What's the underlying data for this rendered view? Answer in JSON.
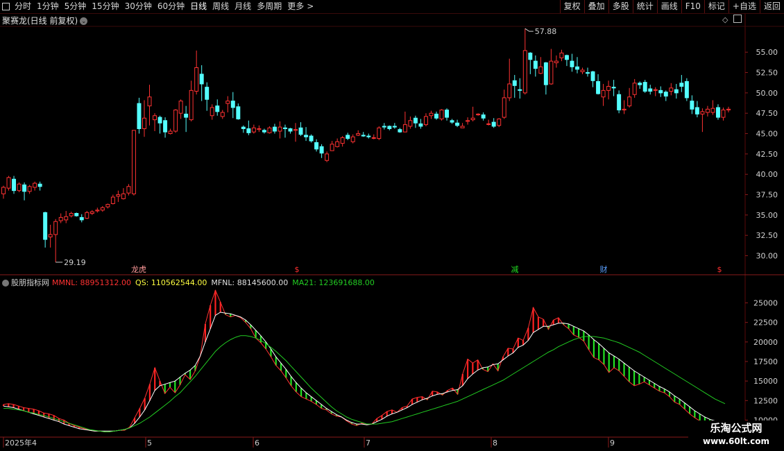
{
  "toolbar": {
    "periods": [
      "分时",
      "1分钟",
      "5分钟",
      "15分钟",
      "30分钟",
      "60分钟",
      "日线",
      "周线",
      "月线",
      "多周期",
      "更多"
    ],
    "active_period": "日线",
    "more_arrow": ">",
    "right_buttons": [
      "复权",
      "叠加",
      "多股",
      "统计",
      "画线",
      "F10",
      "标记",
      "+自选",
      "返回"
    ]
  },
  "stock": {
    "title": "聚赛龙(日线 前复权)",
    "dropdown_icon": "chevron-down-icon"
  },
  "price_axis": {
    "labels": [
      "55.00",
      "52.50",
      "50.00",
      "47.50",
      "45.00",
      "42.50",
      "40.00",
      "37.50",
      "35.00",
      "32.50",
      "30.00"
    ],
    "high_marker": "57.88",
    "low_marker": "29.19"
  },
  "event_markers": [
    "龙虎",
    "$",
    "减",
    "财",
    "$"
  ],
  "indicator": {
    "name": "股朋指标网",
    "mmnl_label": "MMNL: 88951312.00",
    "qs_label": "QS: 110562544.00",
    "mfnl_label": "MFNL: 88145600.00",
    "ma21_label": "MA21: 123691688.00",
    "axis_labels": [
      "25000",
      "22500",
      "20000",
      "17500",
      "15000",
      "12500",
      "10000"
    ]
  },
  "date_axis": {
    "labels": [
      "2025年4",
      "5",
      "6",
      "7",
      "8",
      "9"
    ]
  },
  "watermark": {
    "line1": "乐淘公式网",
    "line2": "www.60lt.com"
  },
  "colors": {
    "up": "#ff3232",
    "down": "#54ffff",
    "red_bar": "#ff2020",
    "green_bar": "#22e522",
    "qs_line": "#ffffff",
    "ma_line": "#22cc22",
    "grid": "#5a0a0a"
  },
  "chart_data": {
    "type": "candlestick",
    "y_range": [
      28,
      58
    ],
    "candles": [
      [
        37.6,
        38.4,
        37.0,
        38.6
      ],
      [
        38.3,
        39.6,
        38.0,
        39.8
      ],
      [
        39.4,
        38.0,
        37.6,
        39.8
      ],
      [
        38.0,
        38.8,
        37.8,
        39.0
      ],
      [
        38.7,
        37.9,
        36.8,
        39.0
      ],
      [
        37.9,
        38.5,
        37.6,
        38.7
      ],
      [
        38.4,
        38.9,
        38.0,
        39.1
      ],
      [
        38.8,
        38.5,
        38.0,
        39.1
      ],
      [
        35.3,
        32.0,
        31.0,
        35.4
      ],
      [
        32.3,
        32.6,
        31.0,
        33.8
      ],
      [
        32.6,
        34.2,
        29.2,
        34.5
      ],
      [
        34.3,
        34.7,
        34.0,
        35.2
      ],
      [
        34.4,
        34.8,
        34.0,
        35.5
      ],
      [
        34.9,
        35.2,
        34.7,
        35.4
      ],
      [
        35.2,
        34.9,
        34.8,
        35.3
      ],
      [
        34.7,
        34.4,
        34.1,
        35.1
      ],
      [
        34.6,
        35.3,
        34.5,
        35.5
      ],
      [
        35.2,
        35.4,
        35.0,
        35.6
      ],
      [
        35.5,
        35.6,
        35.3,
        35.9
      ],
      [
        35.6,
        35.9,
        35.4,
        36.1
      ],
      [
        36.0,
        36.3,
        35.8,
        36.4
      ],
      [
        36.4,
        37.2,
        36.3,
        37.5
      ],
      [
        37.3,
        37.5,
        36.6,
        38.0
      ],
      [
        37.0,
        37.6,
        36.9,
        38.3
      ],
      [
        37.7,
        38.5,
        37.4,
        38.8
      ],
      [
        37.6,
        45.4,
        37.4,
        45.4
      ],
      [
        48.7,
        45.6,
        45.0,
        49.4
      ],
      [
        45.6,
        46.9,
        44.6,
        49.1
      ],
      [
        48.4,
        49.5,
        46.0,
        51.0
      ],
      [
        46.7,
        47.2,
        45.3,
        47.5
      ],
      [
        47.0,
        46.3,
        45.0,
        47.2
      ],
      [
        46.6,
        45.2,
        44.5,
        47.0
      ],
      [
        45.0,
        45.3,
        44.9,
        45.6
      ],
      [
        45.3,
        47.9,
        45.1,
        48.0
      ],
      [
        47.5,
        49.0,
        46.8,
        49.2
      ],
      [
        47.4,
        47.0,
        45.2,
        48.4
      ],
      [
        46.7,
        50.3,
        46.5,
        51.5
      ],
      [
        50.2,
        53.1,
        49.8,
        55.2
      ],
      [
        52.3,
        51.1,
        49.0,
        53.4
      ],
      [
        50.7,
        49.2,
        47.8,
        51.3
      ],
      [
        47.2,
        48.2,
        46.7,
        48.6
      ],
      [
        48.4,
        47.7,
        47.2,
        49.2
      ],
      [
        47.1,
        47.6,
        46.8,
        47.9
      ],
      [
        48.7,
        49.0,
        47.6,
        49.6
      ],
      [
        49.0,
        48.2,
        46.9,
        50.1
      ],
      [
        48.3,
        46.8,
        46.7,
        48.7
      ],
      [
        45.8,
        45.6,
        45.1,
        46.0
      ],
      [
        45.6,
        45.1,
        44.8,
        46.6
      ],
      [
        45.2,
        45.7,
        45.0,
        46.1
      ],
      [
        45.5,
        45.6,
        45.2,
        46.0
      ],
      [
        45.4,
        45.2,
        45.0,
        45.6
      ],
      [
        45.1,
        45.7,
        45.0,
        45.9
      ],
      [
        45.8,
        45.3,
        45.0,
        46.2
      ],
      [
        45.3,
        45.8,
        44.4,
        46.5
      ],
      [
        45.7,
        45.6,
        44.5,
        46.1
      ],
      [
        45.6,
        45.3,
        45.0,
        45.7
      ],
      [
        45.4,
        45.5,
        44.0,
        46.3
      ],
      [
        45.7,
        44.9,
        44.7,
        46.4
      ],
      [
        44.8,
        44.6,
        44.1,
        45.8
      ],
      [
        44.7,
        44.1,
        43.9,
        44.9
      ],
      [
        43.9,
        43.1,
        42.8,
        44.3
      ],
      [
        43.4,
        42.6,
        42.0,
        43.7
      ],
      [
        41.7,
        42.5,
        41.5,
        42.8
      ],
      [
        42.9,
        43.7,
        42.9,
        44.1
      ],
      [
        43.4,
        44.0,
        43.3,
        44.4
      ],
      [
        43.8,
        44.5,
        43.4,
        44.7
      ],
      [
        44.8,
        44.4,
        44.2,
        45.1
      ],
      [
        44.0,
        44.6,
        43.8,
        44.9
      ],
      [
        44.8,
        45.0,
        44.7,
        45.4
      ],
      [
        44.8,
        44.7,
        44.6,
        45.2
      ],
      [
        44.7,
        44.6,
        44.4,
        45.0
      ],
      [
        44.5,
        44.5,
        44.3,
        44.9
      ],
      [
        44.4,
        45.7,
        44.2,
        45.9
      ],
      [
        45.9,
        45.8,
        45.5,
        46.3
      ],
      [
        45.9,
        45.6,
        45.4,
        46.0
      ],
      [
        45.9,
        45.8,
        45.6,
        46.3
      ],
      [
        45.5,
        45.2,
        45.1,
        45.7
      ],
      [
        45.2,
        46.1,
        45.2,
        47.7
      ],
      [
        45.9,
        46.6,
        45.6,
        47.1
      ],
      [
        46.9,
        46.3,
        45.7,
        47.2
      ],
      [
        46.2,
        45.9,
        45.6,
        46.8
      ],
      [
        46.1,
        47.1,
        45.9,
        47.5
      ],
      [
        47.2,
        47.5,
        46.8,
        47.8
      ],
      [
        47.4,
        46.9,
        46.7,
        47.7
      ],
      [
        46.8,
        47.9,
        46.6,
        48.0
      ],
      [
        47.9,
        47.0,
        46.6,
        48.1
      ],
      [
        46.6,
        46.4,
        46.2,
        46.8
      ],
      [
        46.3,
        46.0,
        45.8,
        46.7
      ],
      [
        45.7,
        45.9,
        45.8,
        46.3
      ],
      [
        46.5,
        46.6,
        46.1,
        47.0
      ],
      [
        46.7,
        46.9,
        46.5,
        48.3
      ],
      [
        47.3,
        47.4,
        47.2,
        47.5
      ],
      [
        47.3,
        46.9,
        46.6,
        47.6
      ],
      [
        46.2,
        46.2,
        46.0,
        46.7
      ],
      [
        46.4,
        45.9,
        45.7,
        46.9
      ],
      [
        46.0,
        46.8,
        45.8,
        46.9
      ],
      [
        47.0,
        49.4,
        46.8,
        50.4
      ],
      [
        49.4,
        51.1,
        49.0,
        54.2
      ],
      [
        51.5,
        50.9,
        49.4,
        52.2
      ],
      [
        50.4,
        50.3,
        49.3,
        51.8
      ],
      [
        50.0,
        55.2,
        49.8,
        57.9
      ],
      [
        54.9,
        54.1,
        52.3,
        55.0
      ],
      [
        53.9,
        53.0,
        52.0,
        54.6
      ],
      [
        52.4,
        53.2,
        52.3,
        54.4
      ],
      [
        53.7,
        51.0,
        49.8,
        53.8
      ],
      [
        51.1,
        53.9,
        51.0,
        55.4
      ],
      [
        53.7,
        53.9,
        53.1,
        54.6
      ],
      [
        54.3,
        54.9,
        53.9,
        55.3
      ],
      [
        54.6,
        54.1,
        53.3,
        54.7
      ],
      [
        53.9,
        53.2,
        52.6,
        54.8
      ],
      [
        53.2,
        52.9,
        52.4,
        54.4
      ],
      [
        52.6,
        52.8,
        52.3,
        53.1
      ],
      [
        52.5,
        52.4,
        52.0,
        53.1
      ],
      [
        52.6,
        51.5,
        50.7,
        52.7
      ],
      [
        51.4,
        49.9,
        49.8,
        52.3
      ],
      [
        49.5,
        50.3,
        48.4,
        51.1
      ],
      [
        50.3,
        50.8,
        49.2,
        51.5
      ],
      [
        50.7,
        50.6,
        49.6,
        51.6
      ],
      [
        49.8,
        47.9,
        47.5,
        50.3
      ],
      [
        47.9,
        48.0,
        47.4,
        49.1
      ],
      [
        48.4,
        49.5,
        48.2,
        50.6
      ],
      [
        49.8,
        51.2,
        49.4,
        51.7
      ],
      [
        51.2,
        51.0,
        50.5,
        51.4
      ],
      [
        51.3,
        50.2,
        50.0,
        51.6
      ],
      [
        50.5,
        50.2,
        49.8,
        51.0
      ],
      [
        50.3,
        50.4,
        49.6,
        50.7
      ],
      [
        50.3,
        50.0,
        49.5,
        50.8
      ],
      [
        50.1,
        49.6,
        49.0,
        50.3
      ],
      [
        50.2,
        50.6,
        49.7,
        51.2
      ],
      [
        50.4,
        50.0,
        49.3,
        51.1
      ],
      [
        51.2,
        50.8,
        50.1,
        52.2
      ],
      [
        51.4,
        49.4,
        49.0,
        51.8
      ],
      [
        49.0,
        48.0,
        47.4,
        49.7
      ],
      [
        48.2,
        47.4,
        47.0,
        49.0
      ],
      [
        47.4,
        47.7,
        45.2,
        48.1
      ],
      [
        47.6,
        48.0,
        47.1,
        48.4
      ],
      [
        47.6,
        48.1,
        47.3,
        49.1
      ],
      [
        48.2,
        47.0,
        46.7,
        48.6
      ],
      [
        47.0,
        47.9,
        46.6,
        48.2
      ],
      [
        47.9,
        48.0,
        47.6,
        48.3
      ]
    ],
    "mmnl": [
      12000,
      12100,
      12000,
      11800,
      11600,
      11500,
      11400,
      11200,
      10900,
      10800,
      10600,
      10200,
      10000,
      9600,
      9300,
      9100,
      8900,
      8700,
      8600,
      8600,
      8500,
      8500,
      8600,
      8700,
      8700,
      9100,
      10300,
      11500,
      12800,
      14600,
      16700,
      15000,
      13400,
      14200,
      13500,
      14500,
      15800,
      15200,
      16300,
      18200,
      22300,
      24700,
      26600,
      25100,
      23500,
      23200,
      23400,
      23100,
      22500,
      21700,
      20500,
      19900,
      19100,
      18100,
      17000,
      16300,
      15400,
      14400,
      13600,
      13000,
      12700,
      12400,
      12000,
      11500,
      11300,
      10800,
      10500,
      10400,
      9900,
      9500,
      9300,
      9600,
      9400,
      9500,
      10200,
      10600,
      11100,
      11300,
      11000,
      11600,
      11800,
      12700,
      12900,
      13000,
      12600,
      13700,
      13600,
      13200,
      13800,
      14100,
      13300,
      15900,
      17800,
      17300,
      17700,
      16500,
      16200,
      17200,
      16300,
      18100,
      19200,
      19100,
      20500,
      20200,
      21800,
      24400,
      23200,
      22900,
      21600,
      22800,
      23100,
      22200,
      21700,
      20900,
      20600,
      20100,
      19000,
      18000,
      17700,
      17100,
      16100,
      16700,
      16300,
      15600,
      14900,
      14400,
      14600,
      14900,
      14500,
      14100,
      13700,
      13500,
      13000,
      12300,
      12000,
      11400,
      10800,
      10300,
      9900,
      9700,
      9500,
      9300,
      9200,
      9400
    ],
    "qs": [
      11800,
      11700,
      11600,
      11400,
      11200,
      11000,
      10800,
      10600,
      10400,
      10200,
      10000,
      9800,
      9500,
      9300,
      9100,
      8900,
      8800,
      8700,
      8600,
      8600,
      8600,
      8600,
      8600,
      8700,
      8800,
      9000,
      9600,
      10400,
      11300,
      12500,
      13800,
      14400,
      14600,
      14800,
      15000,
      15500,
      16000,
      16400,
      17000,
      18200,
      20000,
      21700,
      23400,
      23800,
      23700,
      23600,
      23400,
      23200,
      22800,
      22200,
      21500,
      20800,
      20000,
      19100,
      18100,
      17300,
      16500,
      15600,
      14800,
      14100,
      13500,
      13000,
      12500,
      12000,
      11500,
      11100,
      10700,
      10400,
      10000,
      9700,
      9500,
      9500,
      9400,
      9500,
      9800,
      10100,
      10500,
      10800,
      11000,
      11300,
      11600,
      12000,
      12300,
      12600,
      12800,
      13100,
      13300,
      13400,
      13600,
      13800,
      13900,
      14400,
      15300,
      15900,
      16400,
      16700,
      16800,
      17100,
      17200,
      17700,
      18200,
      18600,
      19300,
      19600,
      20200,
      21200,
      21600,
      22000,
      22000,
      22200,
      22400,
      22400,
      22300,
      22000,
      21700,
      21400,
      20900,
      20300,
      19800,
      19200,
      18600,
      18200,
      17800,
      17300,
      16800,
      16300,
      15900,
      15500,
      15100,
      14700,
      14300,
      14000,
      13600,
      13100,
      12700,
      12200,
      11700,
      11200,
      10800,
      10400,
      10100,
      9900,
      9700,
      9600
    ],
    "ma21": [
      11500,
      11500,
      11400,
      11300,
      11200,
      11000,
      10900,
      10700,
      10600,
      10400,
      10200,
      10000,
      9800,
      9600,
      9400,
      9200,
      9000,
      8800,
      8700,
      8600,
      8500,
      8500,
      8600,
      8700,
      8800,
      9000,
      9300,
      9600,
      10000,
      10400,
      10900,
      11400,
      11900,
      12400,
      13000,
      13500,
      14200,
      14900,
      15600,
      16400,
      17200,
      18000,
      18800,
      19400,
      19900,
      20300,
      20600,
      20800,
      20800,
      20700,
      20500,
      20200,
      19800,
      19300,
      18800,
      18200,
      17600,
      16900,
      16200,
      15500,
      14800,
      14100,
      13500,
      12900,
      12300,
      11700,
      11200,
      10800,
      10400,
      10100,
      9900,
      9700,
      9500,
      9500,
      9500,
      9600,
      9700,
      9800,
      10000,
      10200,
      10400,
      10600,
      10800,
      11000,
      11200,
      11400,
      11600,
      11800,
      12000,
      12200,
      12400,
      12700,
      13000,
      13300,
      13600,
      13900,
      14200,
      14500,
      14800,
      15100,
      15500,
      15900,
      16300,
      16700,
      17100,
      17500,
      17900,
      18300,
      18700,
      19000,
      19400,
      19700,
      20000,
      20300,
      20500,
      20700,
      20700,
      20700,
      20600,
      20500,
      20300,
      20100,
      19900,
      19600,
      19300,
      19000,
      18700,
      18300,
      17900,
      17500,
      17100,
      16700,
      16300,
      15900,
      15500,
      15100,
      14700,
      14300,
      13900,
      13500,
      13100,
      12700,
      12400,
      12100
    ],
    "indicator_y_range": [
      8000,
      27000
    ]
  }
}
